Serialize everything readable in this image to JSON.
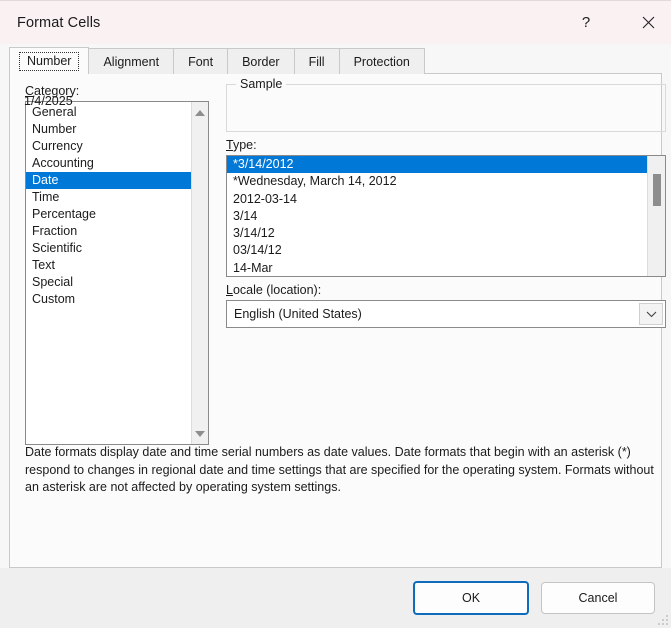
{
  "window": {
    "title": "Format Cells",
    "help_icon": "question-mark-icon",
    "close_icon": "close-icon"
  },
  "tabs": [
    {
      "label": "Number",
      "selected": true
    },
    {
      "label": "Alignment",
      "selected": false
    },
    {
      "label": "Font",
      "selected": false
    },
    {
      "label": "Border",
      "selected": false
    },
    {
      "label": "Fill",
      "selected": false
    },
    {
      "label": "Protection",
      "selected": false
    }
  ],
  "category": {
    "label": "Category:",
    "items": [
      "General",
      "Number",
      "Currency",
      "Accounting",
      "Date",
      "Time",
      "Percentage",
      "Fraction",
      "Scientific",
      "Text",
      "Special",
      "Custom"
    ],
    "selected": "Date"
  },
  "sample": {
    "group_title": "Sample",
    "value": "1/4/2025"
  },
  "type": {
    "label": "Type:",
    "items": [
      "*3/14/2012",
      "*Wednesday, March 14, 2012",
      "2012-03-14",
      "3/14",
      "3/14/12",
      "03/14/12",
      "14-Mar"
    ],
    "selected": "*3/14/2012"
  },
  "locale": {
    "label": "Locale (location):",
    "value": "English (United States)",
    "arrow_icon": "chevron-down-icon"
  },
  "description": "Date formats display date and time serial numbers as date values.  Date formats that begin with an asterisk (*) respond to changes in regional date and time settings that are specified for the operating system. Formats without an asterisk are not affected by operating system settings.",
  "footer": {
    "ok_label": "OK",
    "cancel_label": "Cancel"
  },
  "colors": {
    "selection_blue": "#0078d7",
    "default_button_border": "#0f6cbd",
    "titlebar_bg": "#faf1f3",
    "panel_bg": "#fbfbfb",
    "dialog_bg": "#f7f7f7"
  }
}
